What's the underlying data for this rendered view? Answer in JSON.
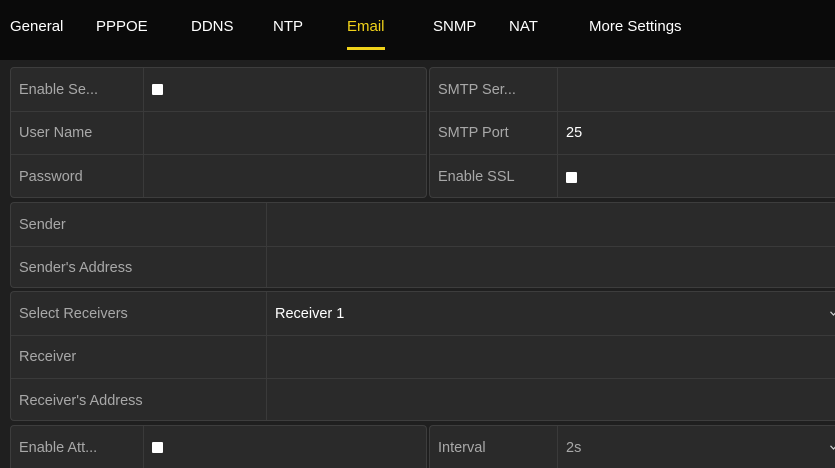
{
  "tabs": [
    {
      "label": "General",
      "active": false
    },
    {
      "label": "PPPOE",
      "active": false
    },
    {
      "label": "DDNS",
      "active": false
    },
    {
      "label": "NTP",
      "active": false
    },
    {
      "label": "Email",
      "active": true
    },
    {
      "label": "SNMP",
      "active": false
    },
    {
      "label": "NAT",
      "active": false
    },
    {
      "label": "More Settings",
      "active": false
    }
  ],
  "server_panel": {
    "enable_server_auth_label": "Enable Se...",
    "enable_server_auth_checked": false,
    "user_name_label": "User Name",
    "user_name_value": "",
    "password_label": "Password",
    "password_value": ""
  },
  "smtp_panel": {
    "smtp_server_label": "SMTP Ser...",
    "smtp_server_value": "",
    "smtp_port_label": "SMTP Port",
    "smtp_port_value": "25",
    "enable_ssl_label": "Enable SSL",
    "enable_ssl_checked": false
  },
  "sender_panel": {
    "sender_label": "Sender",
    "sender_value": "",
    "sender_address_label": "Sender's Address",
    "sender_address_value": ""
  },
  "receiver_panel": {
    "select_receivers_label": "Select Receivers",
    "select_receivers_value": "Receiver 1",
    "receiver_label": "Receiver",
    "receiver_value": "",
    "receiver_address_label": "Receiver's Address",
    "receiver_address_value": ""
  },
  "attachment_panel": {
    "enable_attached_label": "Enable Att...",
    "enable_attached_checked": false
  },
  "interval_panel": {
    "interval_label": "Interval",
    "interval_value": "2s"
  },
  "colors": {
    "tab_active": "#f0d21a",
    "background": "#1f1f1f",
    "panel": "#2a2a2a",
    "tabbar": "#0a0a0a"
  }
}
